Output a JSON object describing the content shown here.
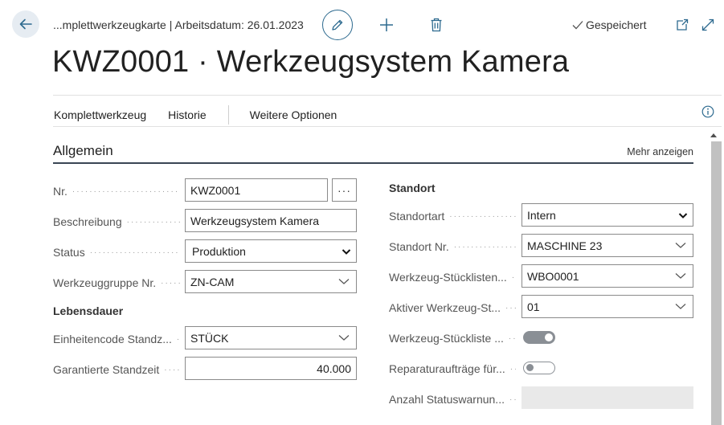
{
  "header": {
    "breadcrumb": "...mplettwerkzeugkarte | Arbeitsdatum: 26.01.2023",
    "saved_label": "Gespeichert",
    "title": "KWZ0001 · Werkzeugsystem Kamera"
  },
  "actions": {
    "komplettwerkzeug": "Komplettwerkzeug",
    "historie": "Historie",
    "weitere_optionen": "Weitere Optionen"
  },
  "section": {
    "title": "Allgemein",
    "more_label": "Mehr anzeigen"
  },
  "left": {
    "nr_label": "Nr.",
    "nr_value": "KWZ0001",
    "assist_label": "···",
    "beschreibung_label": "Beschreibung",
    "beschreibung_value": "Werkzeugsystem Kamera",
    "status_label": "Status",
    "status_value": "Produktion",
    "werkzeuggruppe_label": "Werkzeuggruppe Nr.",
    "werkzeuggruppe_value": "ZN-CAM",
    "lebensdauer_title": "Lebensdauer",
    "einheitencode_label": "Einheitencode Standz...",
    "einheitencode_value": "STÜCK",
    "garantierte_label": "Garantierte Standzeit",
    "garantierte_value": "40.000"
  },
  "right": {
    "standort_title": "Standort",
    "standortart_label": "Standortart",
    "standortart_value": "Intern",
    "standort_nr_label": "Standort Nr.",
    "standort_nr_value": "MASCHINE 23",
    "stueckliste_label": "Werkzeug-Stücklisten...",
    "stueckliste_value": "WBO0001",
    "aktiver_label": "Aktiver Werkzeug-St...",
    "aktiver_value": "01",
    "stueckliste_toggle_label": "Werkzeug-Stückliste ...",
    "stueckliste_toggle_on": true,
    "reparatur_label": "Reparaturaufträge für...",
    "reparatur_on": false,
    "anzahl_label": "Anzahl Statuswarnun..."
  },
  "icons": {
    "back": "arrow-left-icon",
    "edit": "pencil-icon",
    "new": "plus-icon",
    "delete": "trash-icon",
    "saved": "checkmark-icon",
    "open_new_window": "open-in-new-window-icon",
    "expand": "expand-icon",
    "info": "info-icon",
    "dropdown": "chevron-down-icon"
  },
  "colors": {
    "accent": "#2d6a8f",
    "section_line": "#3a4654"
  }
}
